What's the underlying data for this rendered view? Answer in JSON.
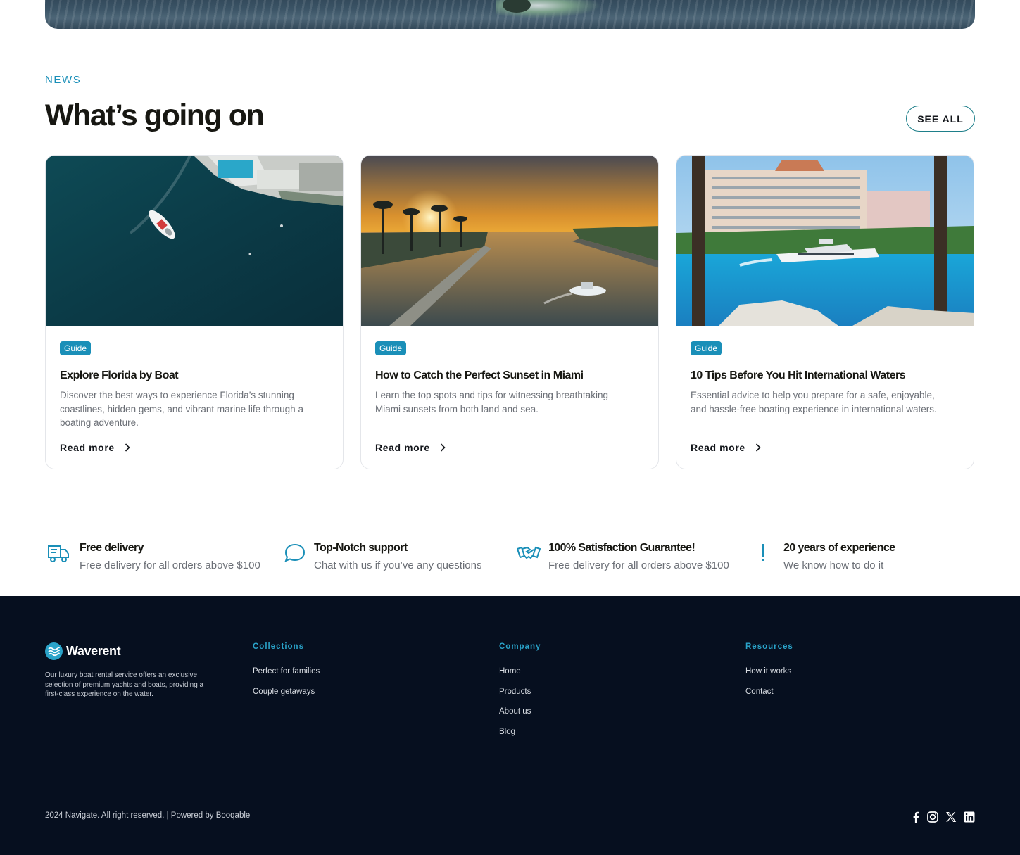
{
  "news": {
    "eyebrow": "NEWS",
    "title": "What’s going on",
    "see_all_label": "SEE ALL",
    "cards": [
      {
        "badge": "Guide",
        "title": "Explore Florida by Boat",
        "description": "Discover the best ways to experience Florida’s stunning coastlines, hidden gems, and vibrant marine life through a boating adventure.",
        "read_more": "Read more"
      },
      {
        "badge": "Guide",
        "title": "How to Catch the Perfect Sunset in Miami",
        "description": "Learn the top spots and tips for witnessing breathtaking Miami sunsets from both land and sea.",
        "read_more": "Read more"
      },
      {
        "badge": "Guide",
        "title": "10 Tips Before You Hit International Waters",
        "description": "Essential advice to help you prepare for a safe, enjoyable, and hassle-free boating experience in international waters.",
        "read_more": "Read more"
      }
    ]
  },
  "features": [
    {
      "icon": "delivery-truck-icon",
      "title": "Free delivery",
      "description": "Free delivery for all orders above $100"
    },
    {
      "icon": "chat-bubble-icon",
      "title": "Top-Notch support",
      "description": "Chat with us if you’ve any questions"
    },
    {
      "icon": "handshake-icon",
      "title": "100% Satisfaction Guarantee!",
      "description": "Free delivery for all orders above $100"
    },
    {
      "icon": "exclamation-icon",
      "title": "20 years of experience",
      "description": "We know how to do it"
    }
  ],
  "footer": {
    "brand": "Waverent",
    "about": "Our luxury boat rental service offers an exclusive selection of premium yachts and boats, providing a first-class experience on the water.",
    "columns": [
      {
        "title": "Collections",
        "links": [
          "Perfect for families",
          "Couple getaways"
        ]
      },
      {
        "title": "Company",
        "links": [
          "Home",
          "Products",
          "About us",
          "Blog"
        ]
      },
      {
        "title": "Resources",
        "links": [
          "How it works",
          "Contact"
        ]
      }
    ],
    "copyright": "2024 Navigate. All right reserved. | Powered by Booqable",
    "social": [
      "facebook-icon",
      "instagram-icon",
      "x-icon",
      "linkedin-icon"
    ]
  },
  "colors": {
    "accent": "#1a8fb8",
    "footer_bg": "#060f1f",
    "heading": "#171712",
    "muted_text": "#6b6f76"
  }
}
